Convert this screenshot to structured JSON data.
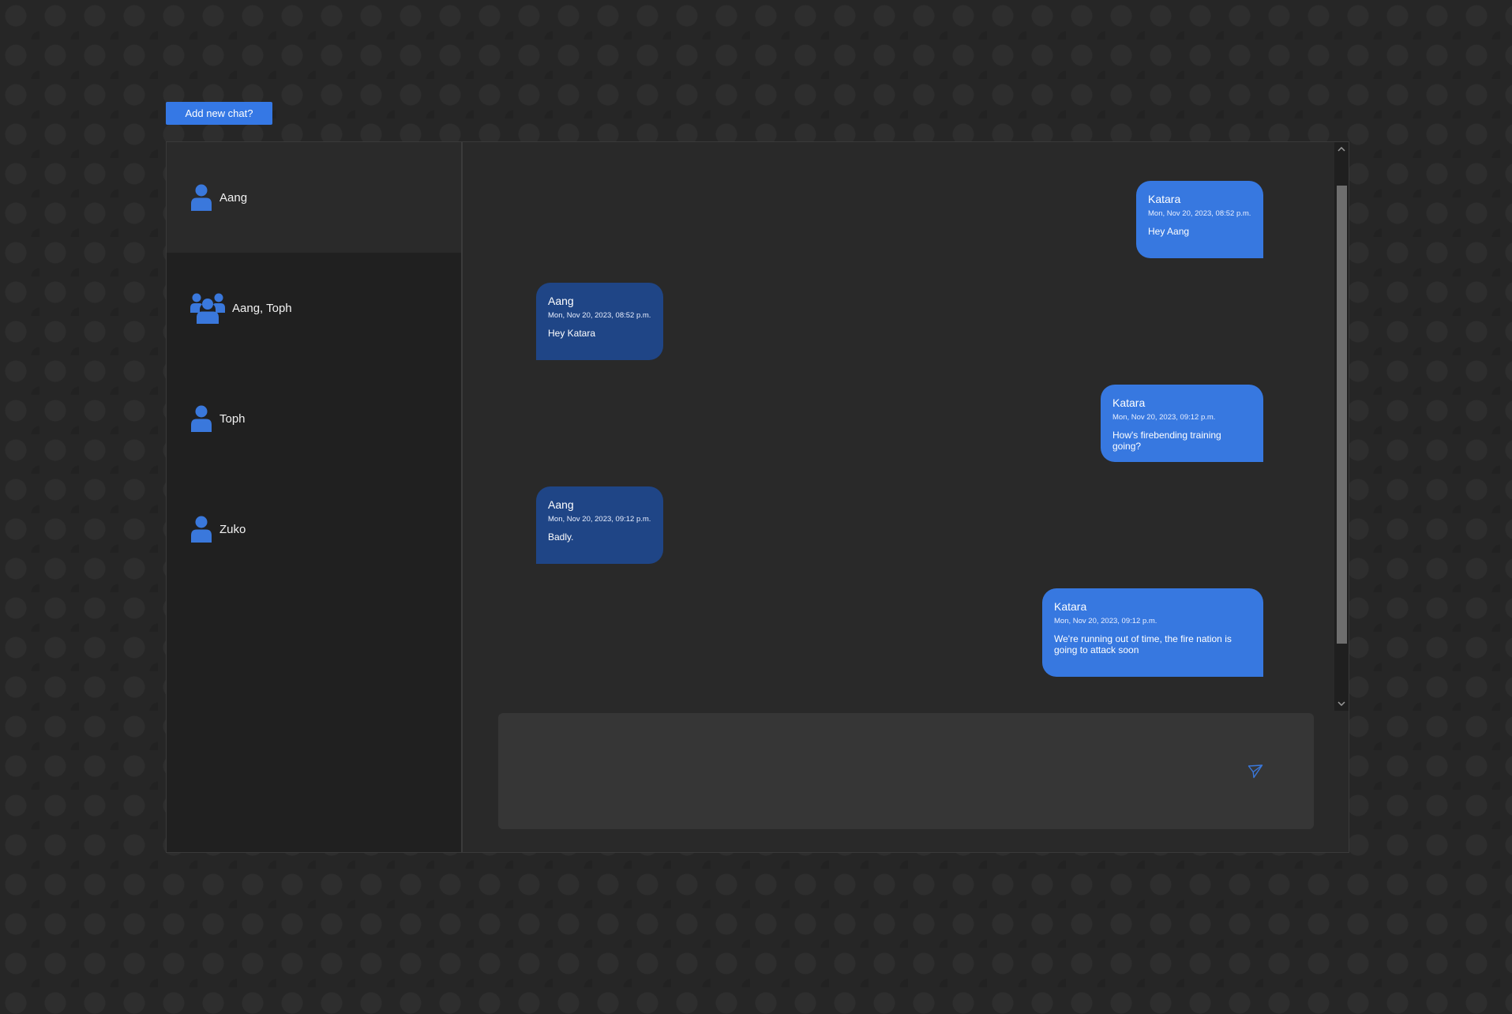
{
  "add_chat_button": {
    "label": "Add new chat?"
  },
  "sidebar": {
    "chats": [
      {
        "label": "Aang",
        "icon": "user-icon",
        "active": true
      },
      {
        "label": "Aang, Toph",
        "icon": "group-icon",
        "active": false
      },
      {
        "label": "Toph",
        "icon": "user-icon",
        "active": false
      },
      {
        "label": "Zuko",
        "icon": "user-icon",
        "active": false
      }
    ]
  },
  "messages": [
    {
      "sender": "Katara",
      "time": "Mon, Nov 20, 2023, 08:52 p.m.",
      "text": "Hey Aang",
      "direction": "sent"
    },
    {
      "sender": "Aang",
      "time": "Mon, Nov 20, 2023, 08:52 p.m.",
      "text": "Hey Katara",
      "direction": "received"
    },
    {
      "sender": "Katara",
      "time": "Mon, Nov 20, 2023, 09:12 p.m.",
      "text": "How's firebending training going?",
      "direction": "sent"
    },
    {
      "sender": "Aang",
      "time": "Mon, Nov 20, 2023, 09:12 p.m.",
      "text": "Badly.",
      "direction": "received"
    },
    {
      "sender": "Katara",
      "time": "Mon, Nov 20, 2023, 09:12 p.m.",
      "text": "We're running out of time, the fire nation is going to attack soon",
      "direction": "sent"
    }
  ],
  "composer": {
    "placeholder": "",
    "value": "",
    "send_icon": "send-icon"
  },
  "colors": {
    "accent": "#3578e5",
    "sent_bubble": "#3778e0",
    "received_bubble": "#1f4586",
    "sidebar_bg": "#202020",
    "panel_bg": "#292929",
    "composer_bg": "#363636"
  }
}
